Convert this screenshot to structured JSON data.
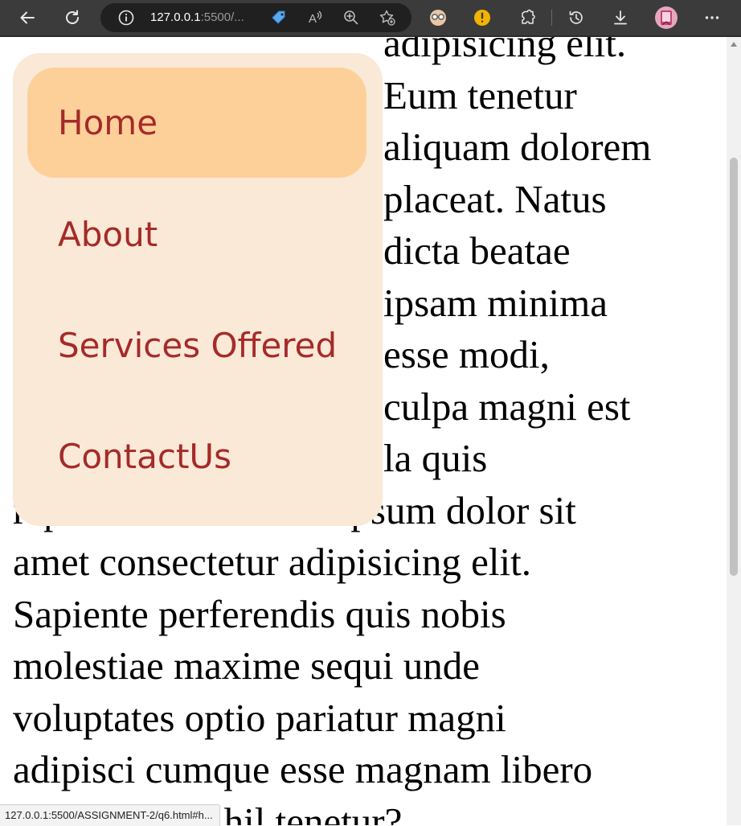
{
  "browser": {
    "url_host": "127.0.0.1",
    "url_rest": ":5500/...",
    "status_url": "127.0.0.1:5500/ASSIGNMENT-2/q6.html#h...",
    "icons": [
      "back-icon",
      "refresh-icon",
      "info-icon",
      "tag-icon",
      "read-aloud-icon",
      "zoom-icon",
      "favorite-icon",
      "extension-glasses-icon",
      "extension-alert-icon",
      "extensions-icon",
      "history-icon",
      "download-icon",
      "profile-avatar",
      "more-icon"
    ]
  },
  "nav": {
    "items": [
      {
        "label": "Home",
        "active": true
      },
      {
        "label": "About",
        "active": false
      },
      {
        "label": "Services Offered",
        "active": false
      },
      {
        "label": "ContactUs",
        "active": false
      }
    ]
  },
  "content": {
    "lines": [
      "adipisicing elit.",
      "Eum tenetur",
      "aliquam dolorem",
      "placeat. Natus",
      "dicta beatae",
      "ipsam minima",
      "esse modi,",
      "culpa magni est",
      "la quis",
      "repudiandae. Lorem ipsum dolor sit",
      "amet consectetur adipisicing elit.",
      "Sapiente perferendis quis nobis",
      "molestiae maxime sequi unde",
      "voluptates optio pariatur magni",
      "adipisci cumque esse magnam libero",
      "accusamus nihil tenetur?"
    ]
  },
  "colors": {
    "menu_bg": "#f9e9d6",
    "menu_active_bg": "#fdd09a",
    "menu_text": "#a52a2a",
    "toolbar_bg": "#3b3b3b"
  }
}
